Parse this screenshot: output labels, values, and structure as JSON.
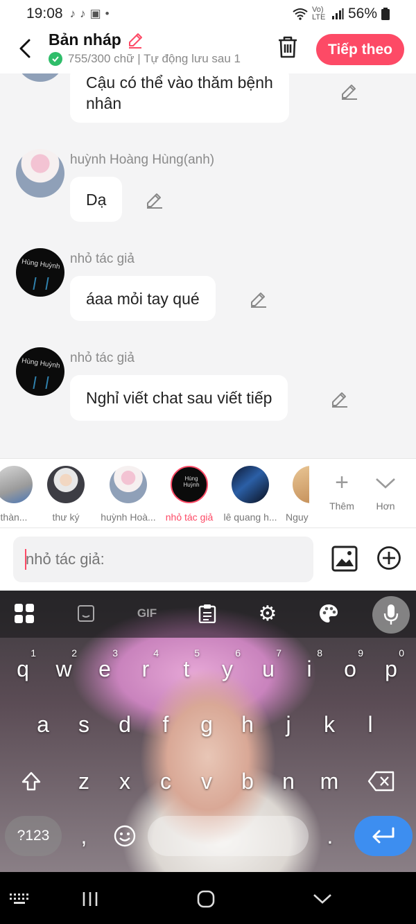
{
  "status_bar": {
    "time": "19:08",
    "battery": "56%",
    "network": "Vo) LTE"
  },
  "header": {
    "title": "Bản nháp",
    "subtitle": "755/300 chữ | Tự động lưu sau 1",
    "next_label": "Tiếp theo"
  },
  "messages": [
    {
      "name": "",
      "text_line1": "Cậu có thể vào thăm bệnh",
      "text_line2": "nhân"
    },
    {
      "name": "huỳnh Hoàng Hùng(anh)",
      "text": "Dạ"
    },
    {
      "name": "nhỏ tác giả",
      "text": "áaa mỏi tay qué",
      "avatar_text": "Hùng Huỳnh"
    },
    {
      "name": "nhỏ tác giả",
      "text": "Nghỉ viết chat sau viết tiếp",
      "avatar_text": "Hùng Huỳnh"
    }
  ],
  "characters": [
    {
      "label": "thàn..."
    },
    {
      "label": "thư ký"
    },
    {
      "label": "huỳnh Hoà..."
    },
    {
      "label": "nhỏ tác giả"
    },
    {
      "label": "lê quang h..."
    },
    {
      "label": "Nguy"
    }
  ],
  "char_avatar_text": "Hùng Huỳnh",
  "tools": {
    "add_label": "Thêm",
    "more_label": "Hơn"
  },
  "input": {
    "placeholder": "nhỏ tác giả:"
  },
  "keyboard": {
    "row1": [
      {
        "k": "q",
        "n": "1"
      },
      {
        "k": "w",
        "n": "2"
      },
      {
        "k": "e",
        "n": "3"
      },
      {
        "k": "r",
        "n": "4"
      },
      {
        "k": "t",
        "n": "5"
      },
      {
        "k": "y",
        "n": "6"
      },
      {
        "k": "u",
        "n": "7"
      },
      {
        "k": "i",
        "n": "8"
      },
      {
        "k": "o",
        "n": "9"
      },
      {
        "k": "p",
        "n": "0"
      }
    ],
    "row2": [
      "a",
      "s",
      "d",
      "f",
      "g",
      "h",
      "j",
      "k",
      "l"
    ],
    "row3": [
      "z",
      "x",
      "c",
      "v",
      "b",
      "n",
      "m"
    ],
    "sym_label": "?123",
    "comma": ",",
    "period": ".",
    "gif_label": "GIF"
  }
}
